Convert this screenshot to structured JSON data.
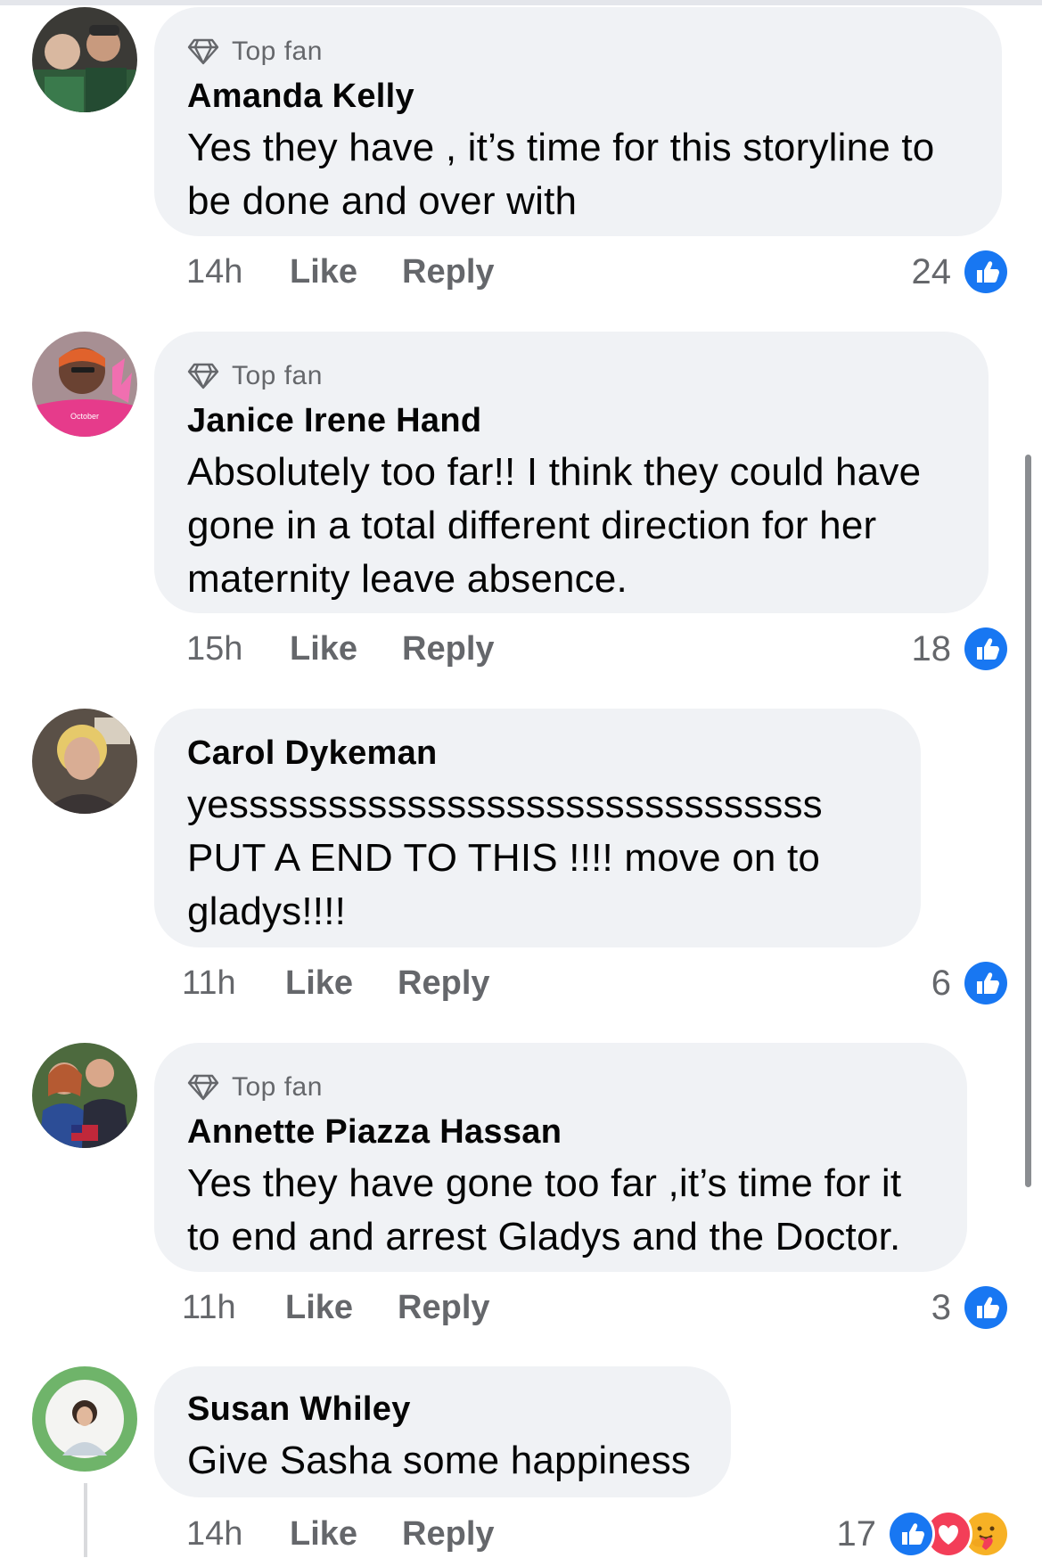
{
  "comments": [
    {
      "author": "Amanda Kelly",
      "badge": "Top fan",
      "text": "Yes they have , it’s time for this storyline to be done and over with",
      "time": "14h",
      "like_label": "Like",
      "reply_label": "Reply",
      "reaction_count": "24",
      "reactions": [
        "like-icon"
      ]
    },
    {
      "author": "Janice Irene Hand",
      "badge": "Top fan",
      "text": "Absolutely too far!! I think they could have gone in a total different direction for her maternity leave absence.",
      "time": "15h",
      "like_label": "Like",
      "reply_label": "Reply",
      "reaction_count": "18",
      "reactions": [
        "like-icon"
      ],
      "avatar_text": "October"
    },
    {
      "author": "Carol Dykeman",
      "badge": "",
      "text": "yessssssssssssssssssssssssssssss PUT A END TO THIS !!!! move on to gladys!!!!",
      "time": "11h",
      "like_label": "Like",
      "reply_label": "Reply",
      "reaction_count": "6",
      "reactions": [
        "like-icon"
      ]
    },
    {
      "author": "Annette Piazza Hassan",
      "badge": "Top fan",
      "text": "Yes they have gone too far ,it’s time for it to end and arrest Gladys and the Doctor.",
      "time": "11h",
      "like_label": "Like",
      "reply_label": "Reply",
      "reaction_count": "3",
      "reactions": [
        "like-icon"
      ]
    },
    {
      "author": "Susan Whiley",
      "badge": "",
      "text": "Give Sasha some happiness",
      "time": "14h",
      "like_label": "Like",
      "reply_label": "Reply",
      "reaction_count": "17",
      "reactions": [
        "like-icon",
        "love-icon",
        "care-icon"
      ]
    }
  ],
  "colors": {
    "bubble_bg": "#f0f2f5",
    "secondary_text": "#65676b",
    "primary_text": "#050505",
    "like_blue": "#1877f2",
    "love_red": "#f33e58",
    "care_yellow": "#f7b125"
  }
}
